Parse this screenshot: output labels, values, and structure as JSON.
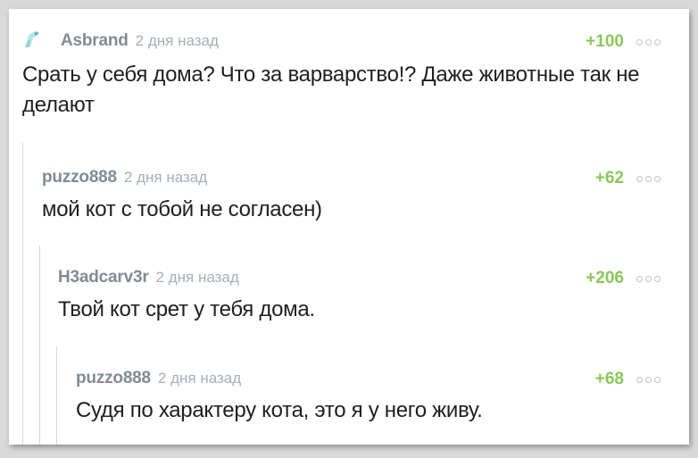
{
  "comments": [
    {
      "author": "Asbrand",
      "time": "2 дня назад",
      "score": "+100",
      "text": "Срать у себя дома? Что за варварство!? Даже животные так не делают",
      "avatar_icon": "bird-avatar-icon"
    },
    {
      "author": "puzzo888",
      "time": "2 дня назад",
      "score": "+62",
      "text": "мой кот с тобой не согласен)"
    },
    {
      "author": "H3adcarv3r",
      "time": "2 дня назад",
      "score": "+206",
      "text": "Твой кот срет у тебя дома."
    },
    {
      "author": "puzzo888",
      "time": "2 дня назад",
      "score": "+68",
      "text": "Судя по характеру кота, это я у него живу."
    }
  ],
  "colors": {
    "author": "#838a93",
    "time": "#a8aeb5",
    "score": "#8ac858",
    "text": "#1f1f1f",
    "thread_line": "#d7d7d7"
  }
}
